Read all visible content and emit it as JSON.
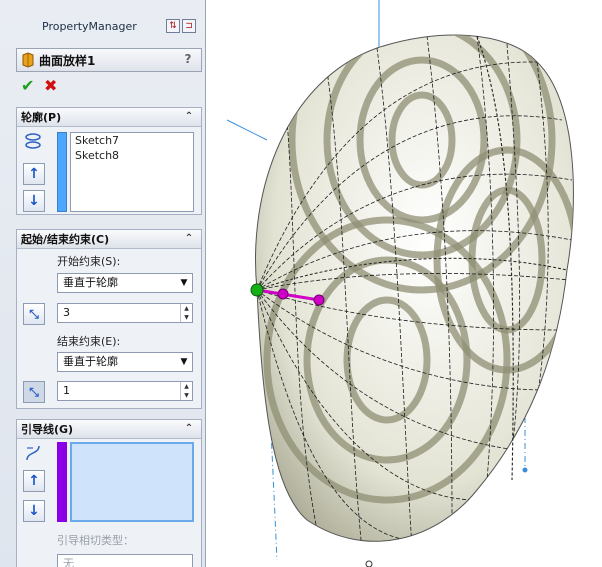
{
  "panel": {
    "title": "PropertyManager",
    "feature_name": "曲面放样1",
    "help": "?",
    "ok_icon": "checkmark-icon",
    "cancel_icon": "x-icon"
  },
  "profiles": {
    "header": "轮廓(P)",
    "items": [
      "Sketch7",
      "Sketch8"
    ],
    "color": "#4da6ff"
  },
  "constraints": {
    "header": "起始/结束约束(C)",
    "start_label": "开始约束(S):",
    "start_value": "垂直于轮廓",
    "start_length": "3",
    "end_label": "结束约束(E):",
    "end_value": "垂直于轮廓",
    "end_length": "1"
  },
  "guides": {
    "header": "引导线(G)",
    "tangency_label": "引导相切类型：",
    "tangency_value": "无",
    "color": "#8a00e6"
  },
  "colors": {
    "accent_blue": "#2d62c2",
    "model_fill": "#c8c8b0",
    "axis_line": "#3a8fd8",
    "handle_green": "#16b016",
    "handle_magenta": "#d100c8"
  }
}
